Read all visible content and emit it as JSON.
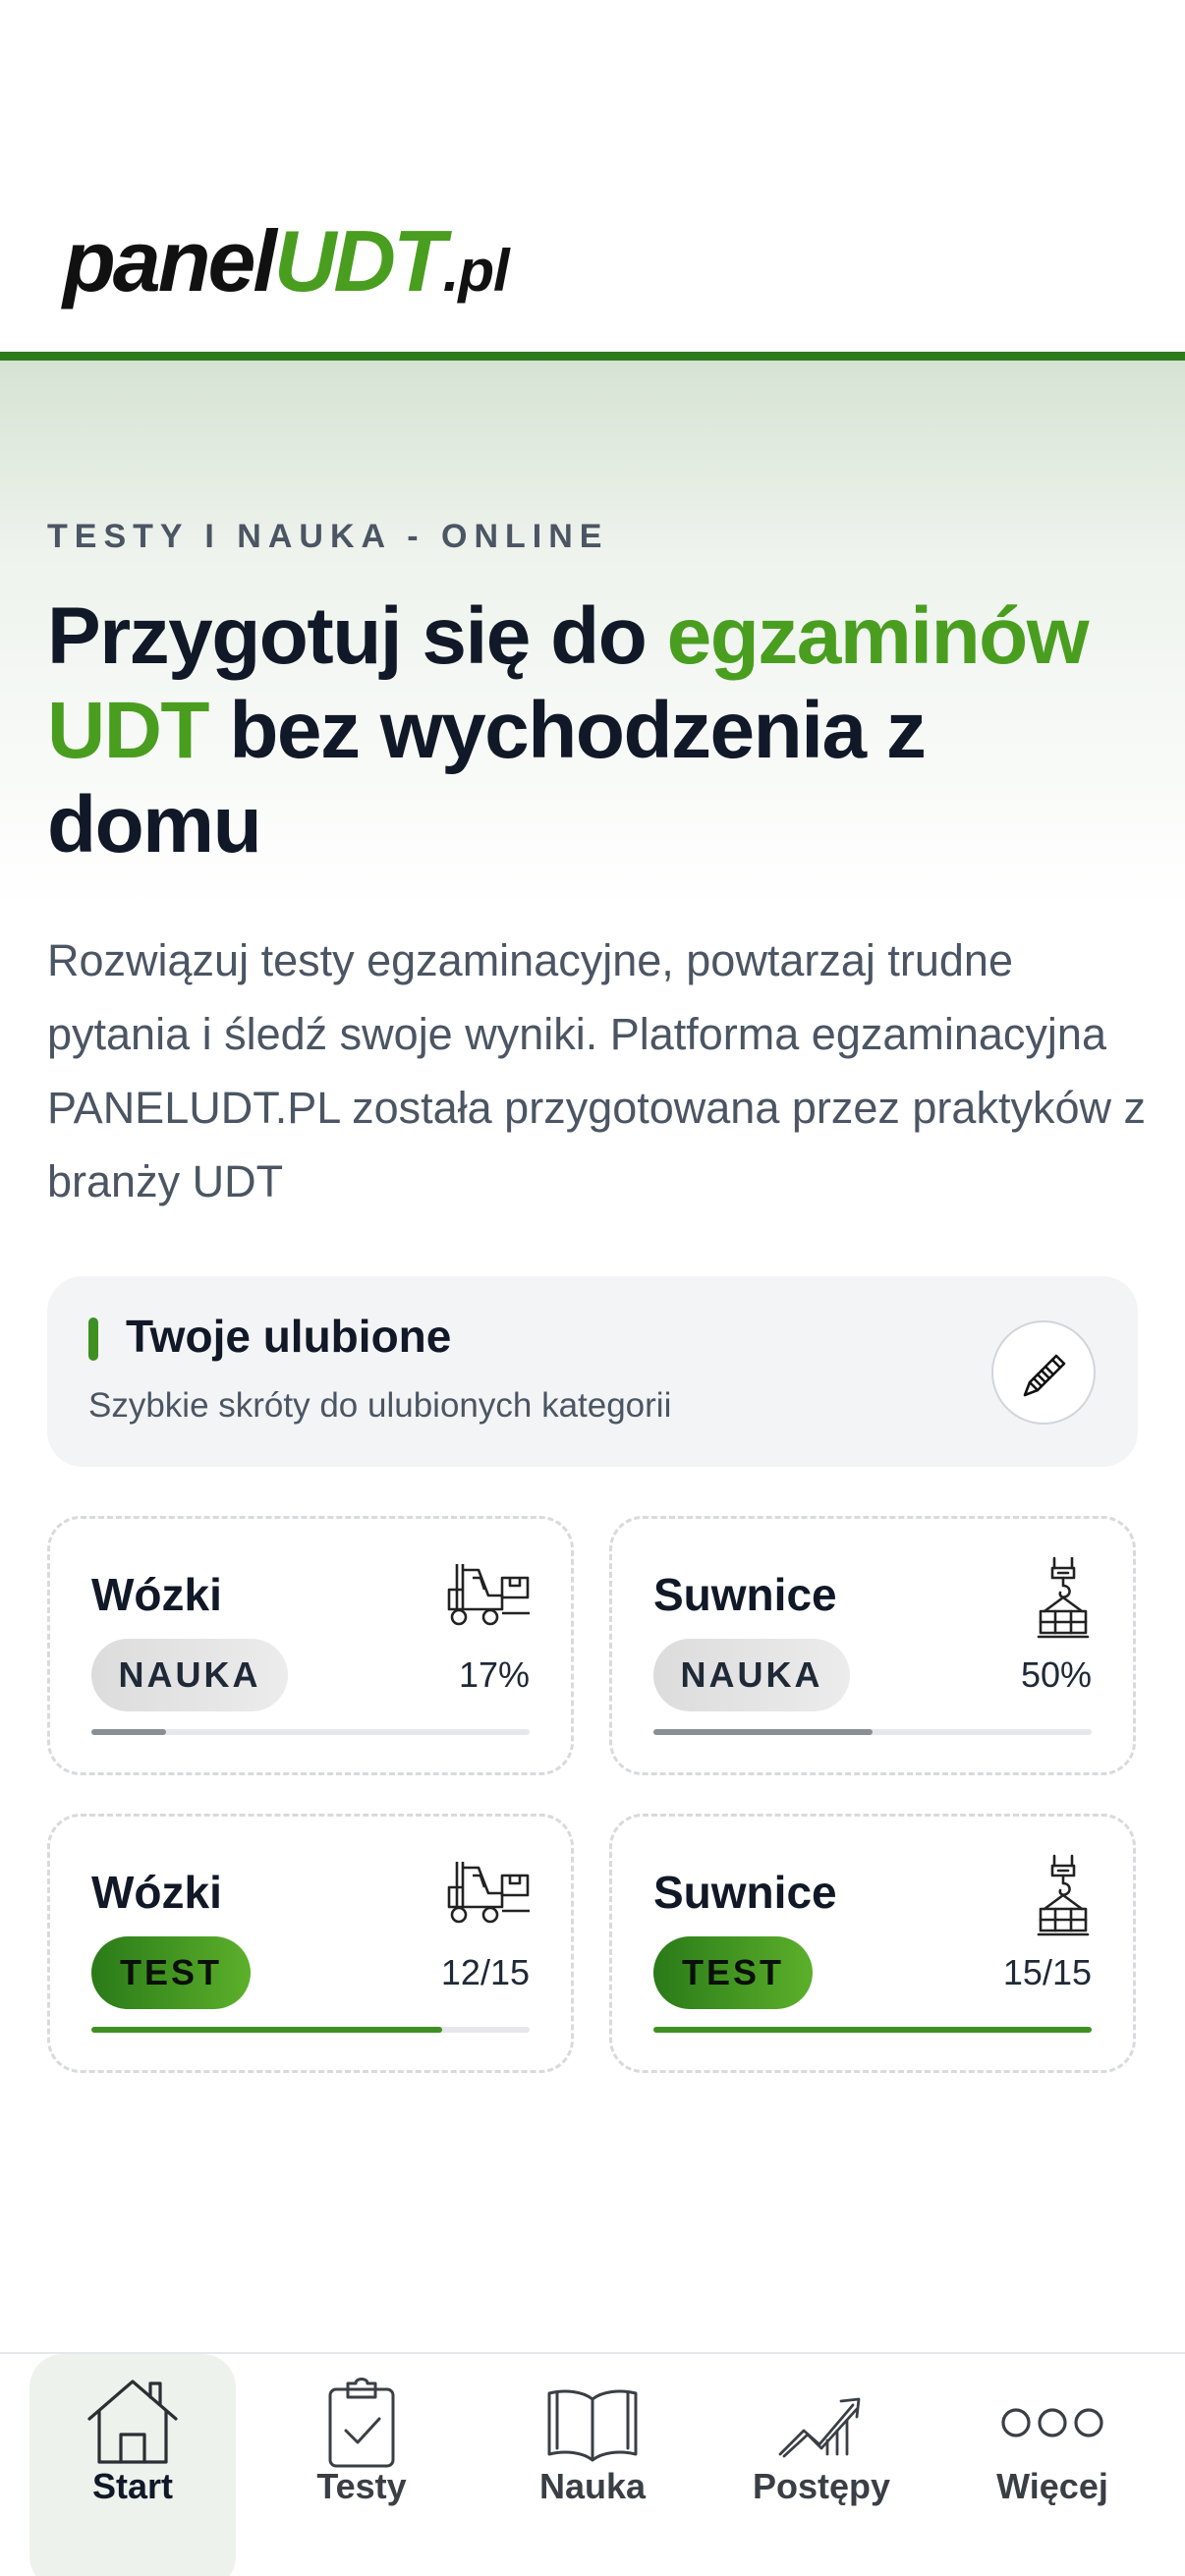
{
  "header": {
    "logo_panel": "panel",
    "logo_udt": "UDT",
    "logo_pl": ".pl"
  },
  "hero": {
    "eyebrow": "TESTY I NAUKA - ONLINE",
    "headline_part1": "Przygotuj się do ",
    "headline_highlight": "egzaminów UDT",
    "headline_part2": " bez wychodzenia z domu",
    "lead": "Rozwiązuj testy egzaminacyjne, powtarzaj trudne pytania i śledź swoje wyniki. Platforma egzaminacyjna PANELUDT.PL została przygotowana przez praktyków z branży UDT"
  },
  "favorites": {
    "title": "Twoje ulubione",
    "subtitle": "Szybkie skróty do ulubionych kategorii",
    "edit_icon": "pencil-icon"
  },
  "tiles": [
    {
      "title": "Wózki",
      "icon": "forklift-icon",
      "mode": "NAUKA",
      "value": "17%",
      "progress": 0.17
    },
    {
      "title": "Suwnice",
      "icon": "crane-hook-icon",
      "mode": "NAUKA",
      "value": "50%",
      "progress": 0.5
    },
    {
      "title": "Wózki",
      "icon": "forklift-icon",
      "mode": "TEST",
      "value": "12/15",
      "progress": 0.8
    },
    {
      "title": "Suwnice",
      "icon": "crane-hook-icon",
      "mode": "TEST",
      "value": "15/15",
      "progress": 1.0
    }
  ],
  "nav": {
    "items": [
      {
        "label": "Start",
        "icon": "home-icon",
        "active": true
      },
      {
        "label": "Testy",
        "icon": "clipboard-check-icon",
        "active": false
      },
      {
        "label": "Nauka",
        "icon": "book-icon",
        "active": false
      },
      {
        "label": "Postępy",
        "icon": "chart-up-icon",
        "active": false
      },
      {
        "label": "Więcej",
        "icon": "more-circles-icon",
        "active": false
      }
    ]
  },
  "colors": {
    "brand_green": "#4a9e1f",
    "dark_green": "#2f7a1e",
    "text_dark": "#111827",
    "text_muted": "#4b5563"
  }
}
